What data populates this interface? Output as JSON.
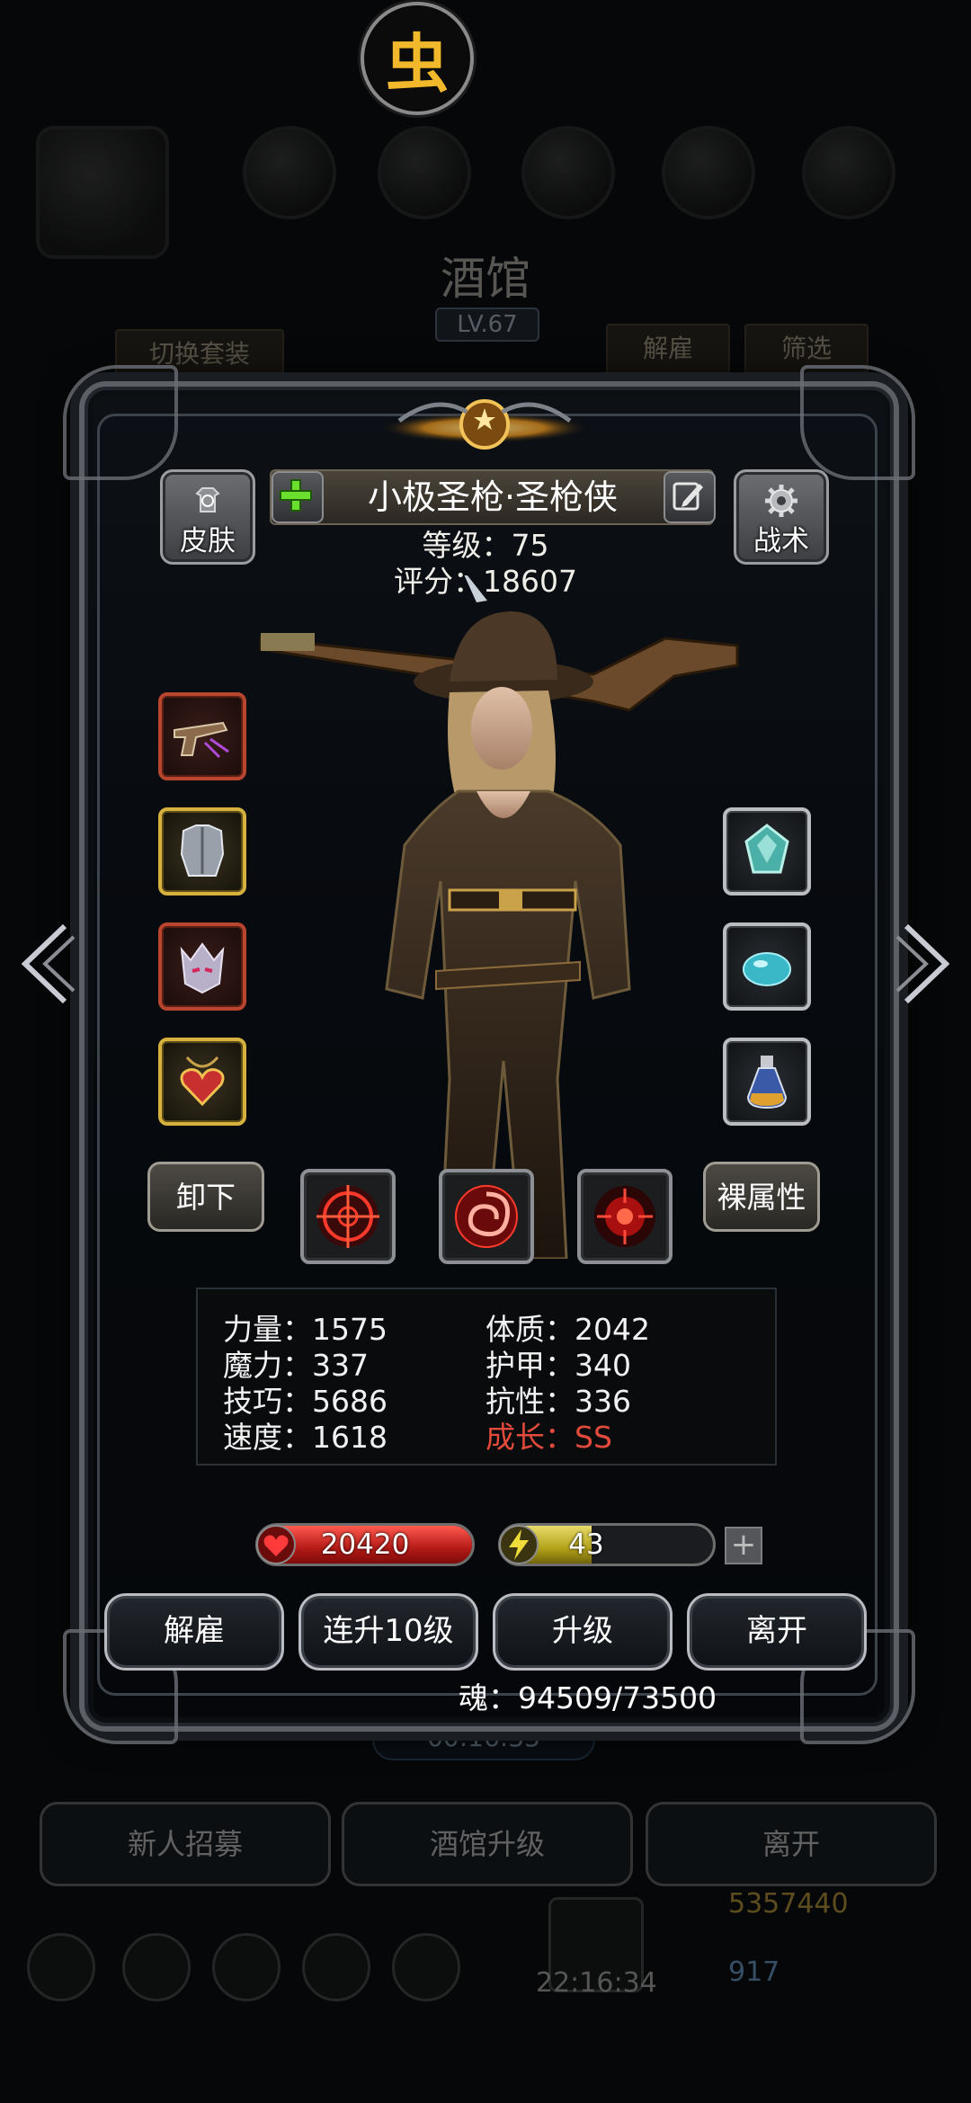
{
  "app_icon": {
    "glyph": "虫",
    "icon": "bug-emblem-icon",
    "color": "#f0b82a"
  },
  "background": {
    "title": "酒馆",
    "level": "LV.67",
    "tabs": {
      "switch_outfit": "切换套装",
      "dismiss": "解雇",
      "filter": "筛选"
    },
    "timer": "00:16:33",
    "bottom_buttons": [
      "新人招募",
      "酒馆升级",
      "离开"
    ],
    "clock": "22:16:34",
    "gold": "5357440",
    "gems": "917"
  },
  "hero": {
    "skin_label": "皮肤",
    "tactics_label": "战术",
    "name": "小极圣枪·圣枪侠",
    "level_text": "等级：75",
    "score_text": "评分：18607"
  },
  "actions_side": {
    "unequip": "卸下",
    "base_attr": "裸属性"
  },
  "stats": {
    "left": [
      "力量：1575",
      "魔力：337",
      "技巧：5686",
      "速度：1618"
    ],
    "right": [
      "体质：2042",
      "护甲：340",
      "抗性：336"
    ],
    "growth": "成长：SS",
    "growth_color": "#e24a3b"
  },
  "bars": {
    "hp": {
      "value": "20420",
      "fill": 1.0,
      "color": "#c62a22"
    },
    "energy": {
      "value": "43",
      "fill": 0.43,
      "color": "#c8b62a"
    },
    "plus": "+"
  },
  "buttons": [
    "解雇",
    "连升10级",
    "升级",
    "离开"
  ],
  "soul": "魂：94509/73500",
  "equipment_left": [
    "pistol-icon",
    "chest-armor-icon",
    "demon-helmet-icon",
    "heart-amulet-icon"
  ],
  "equipment_right": [
    "crystal-gem-icon",
    "blue-stone-icon",
    "potion-flask-icon"
  ],
  "skills": [
    "crosshair-skill-icon",
    "vortex-skill-icon",
    "target-skill-icon"
  ]
}
